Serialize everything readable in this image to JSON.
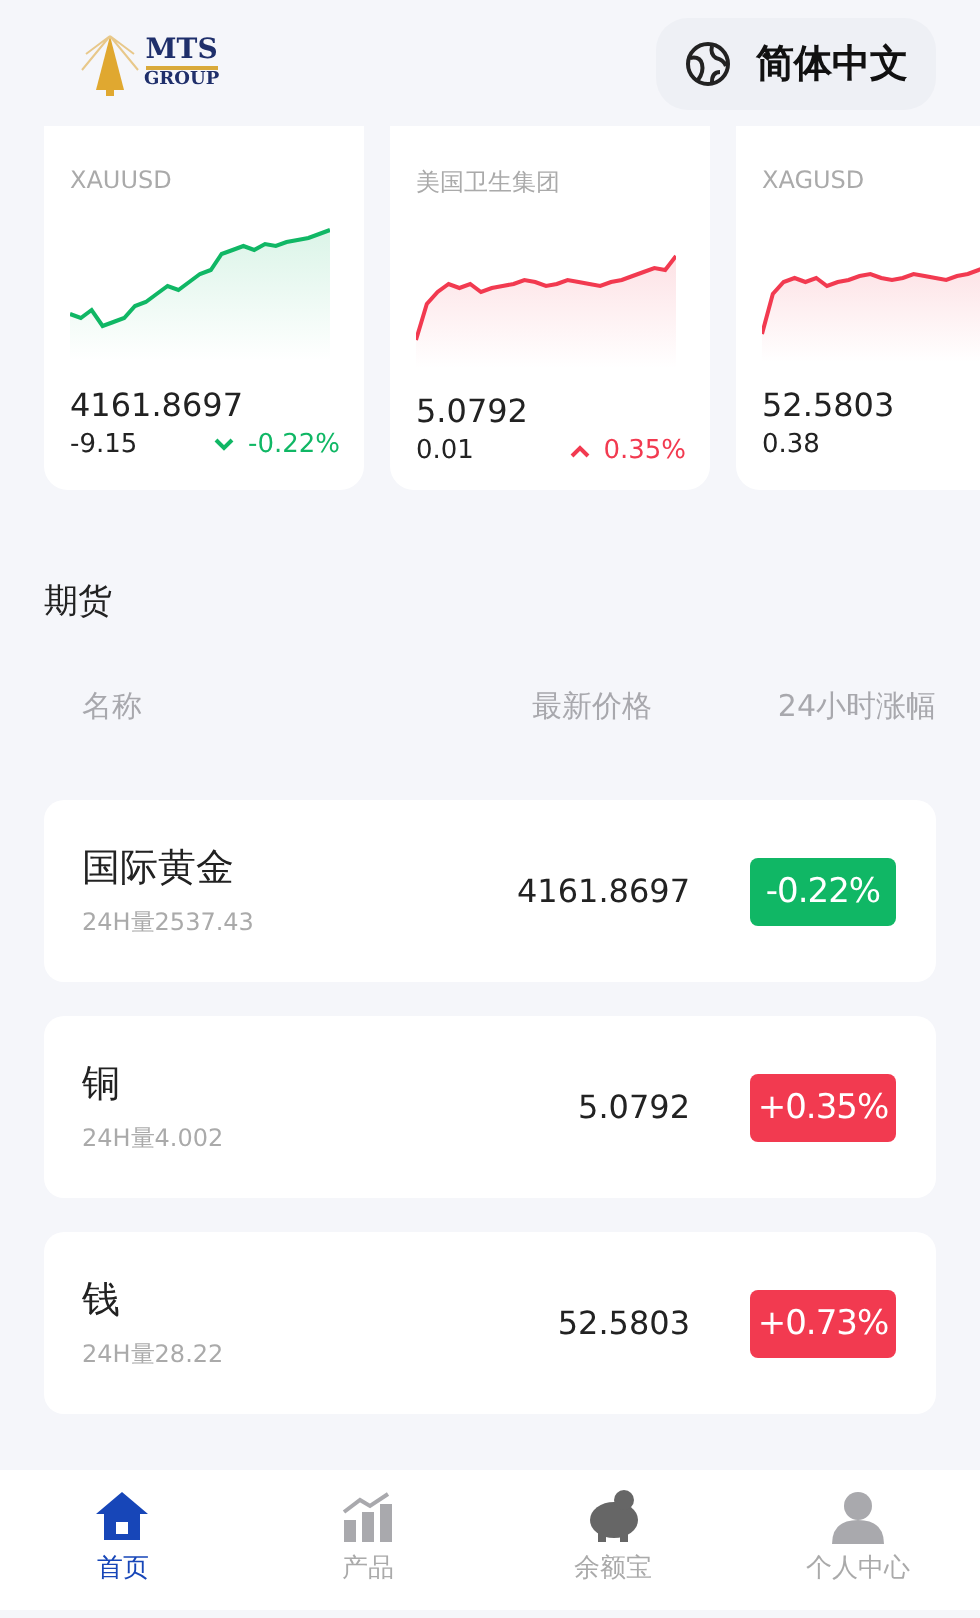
{
  "header": {
    "logo": {
      "line1": "MTS",
      "line2": "GROUP"
    },
    "language": "简体中文"
  },
  "tickers": [
    {
      "symbol": "XAUUSD",
      "price": "4161.8697",
      "change": "-9.15",
      "percent": "-0.22%",
      "rising": false
    },
    {
      "symbol": "美国卫生集团",
      "price": "5.0792",
      "change": "0.01",
      "percent": "0.35%",
      "rising": true
    },
    {
      "symbol": "XAGUSD",
      "price": "52.5803",
      "change": "0.38",
      "rising": true
    }
  ],
  "section_title": "期货",
  "table": {
    "columns": [
      "名称",
      "最新价格",
      "24小时涨幅"
    ],
    "rows": [
      {
        "name": "国际黄金",
        "volume": "24H量2537.43",
        "price": "4161.8697",
        "change": "-0.22%",
        "rising": false
      },
      {
        "name": "铜",
        "volume": "24H量4.002",
        "price": "5.0792",
        "change": "+0.35%",
        "rising": true
      },
      {
        "name": "钱",
        "volume": "24H量28.22",
        "price": "52.5803",
        "change": "+0.73%",
        "rising": true
      }
    ]
  },
  "nav": [
    {
      "label": "首页",
      "selected": true
    },
    {
      "label": "产品",
      "selected": false
    },
    {
      "label": "余额宝",
      "selected": false
    },
    {
      "label": "个人中心",
      "selected": false
    }
  ]
}
